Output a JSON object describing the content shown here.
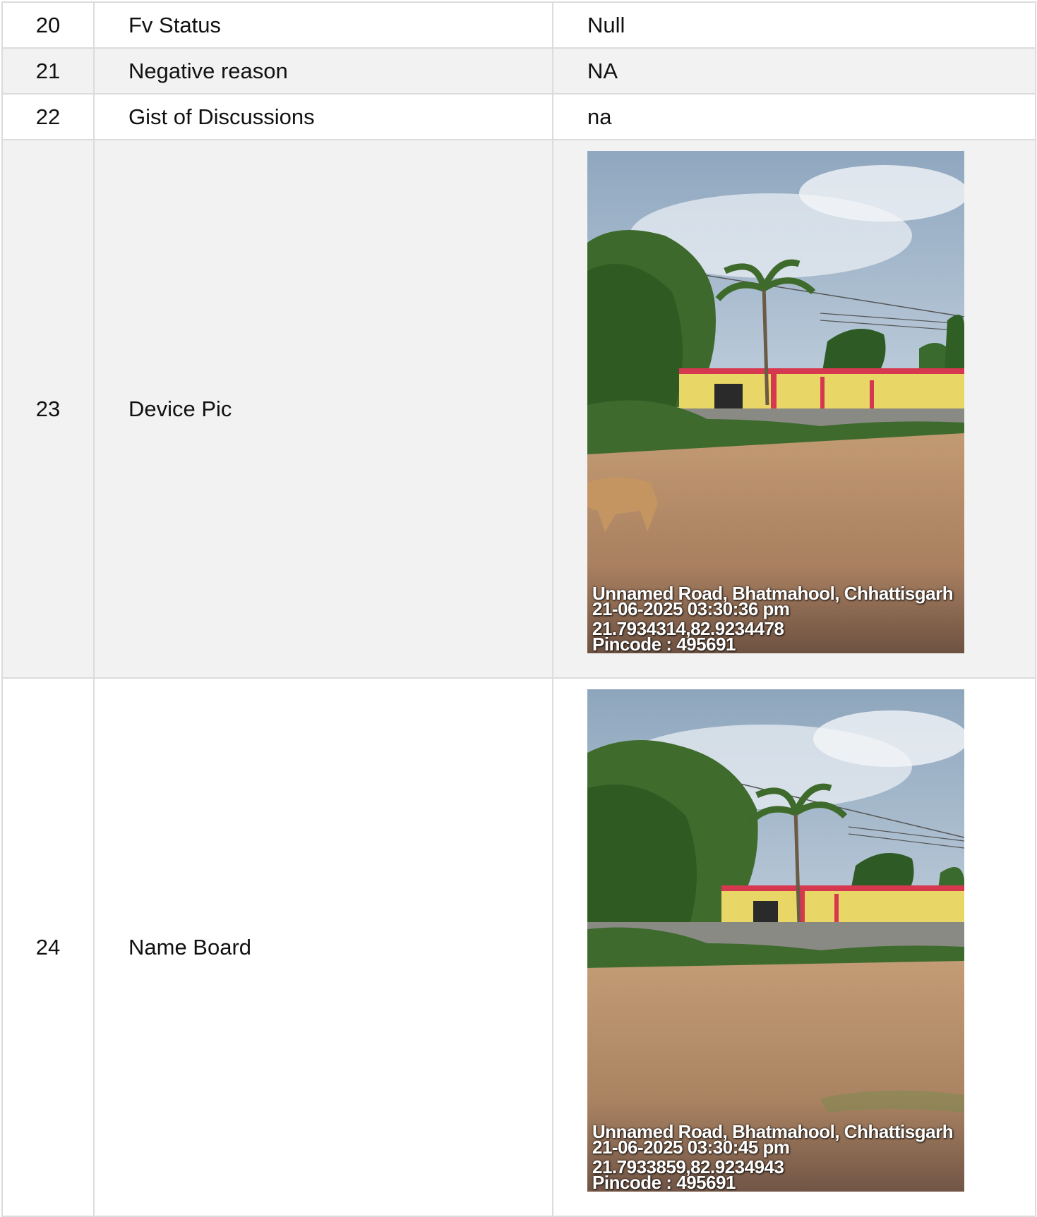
{
  "rows": [
    {
      "num": "20",
      "label": "Fv Status",
      "value": "Null"
    },
    {
      "num": "21",
      "label": "Negative reason",
      "value": "NA"
    },
    {
      "num": "22",
      "label": "Gist of Discussions",
      "value": "na"
    },
    {
      "num": "23",
      "label": "Device Pic",
      "photo": {
        "address": "Unnamed Road, Bhatmahool, Chhattisgarh",
        "datetime": "21-06-2025 03:30:36 pm",
        "coordinates": "21.7934314,82.9234478",
        "pincode": "Pincode : 495691"
      }
    },
    {
      "num": "24",
      "label": "Name Board",
      "photo": {
        "address": "Unnamed Road, Bhatmahool, Chhattisgarh",
        "datetime": "21-06-2025 03:30:45 pm",
        "coordinates": "21.7933859,82.9234943",
        "pincode": "Pincode : 495691"
      }
    }
  ],
  "colors": {
    "border": "#dcdcdc",
    "alt_row": "#f2f2f2"
  }
}
